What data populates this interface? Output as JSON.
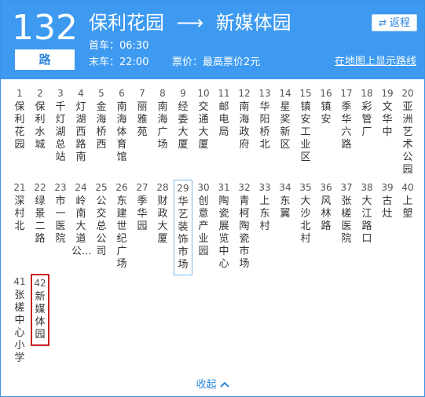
{
  "route": {
    "number": "132",
    "unit": "路",
    "from": "保利花园",
    "arrow": "⟶",
    "to": "新媒体园",
    "first_bus": "首车：06:30",
    "last_bus": "末车：22:00",
    "fare": "票价：最高票价2元",
    "reverse_label": "返程",
    "reverse_icon": "⇄",
    "show_map_label": "在地图上显示路线"
  },
  "stops": [
    {
      "num": "1",
      "name": "保利花园"
    },
    {
      "num": "2",
      "name": "保利水城"
    },
    {
      "num": "3",
      "name": "千灯湖总站"
    },
    {
      "num": "4",
      "name": "灯湖西路南"
    },
    {
      "num": "5",
      "name": "金海桥西"
    },
    {
      "num": "6",
      "name": "南海体育馆"
    },
    {
      "num": "7",
      "name": "丽雅苑"
    },
    {
      "num": "8",
      "name": "南海广场"
    },
    {
      "num": "9",
      "name": "经委大厦"
    },
    {
      "num": "10",
      "name": "交通大厦"
    },
    {
      "num": "11",
      "name": "邮电局"
    },
    {
      "num": "12",
      "name": "南海政府"
    },
    {
      "num": "13",
      "name": "华阳桥北"
    },
    {
      "num": "14",
      "name": "星奖新区"
    },
    {
      "num": "15",
      "name": "镇安工业区"
    },
    {
      "num": "16",
      "name": "镇安"
    },
    {
      "num": "17",
      "name": "季华六路"
    },
    {
      "num": "18",
      "name": "彩管厂"
    },
    {
      "num": "19",
      "name": "文华中"
    },
    {
      "num": "20",
      "name": "亚洲艺术公园"
    },
    {
      "num": "21",
      "name": "深村北"
    },
    {
      "num": "22",
      "name": "绿景二路"
    },
    {
      "num": "23",
      "name": "市一医院"
    },
    {
      "num": "24",
      "name": "岭南大道公..."
    },
    {
      "num": "25",
      "name": "公交总公司"
    },
    {
      "num": "26",
      "name": "东建世纪广场"
    },
    {
      "num": "27",
      "name": "季华园"
    },
    {
      "num": "28",
      "name": "财政大厦"
    },
    {
      "num": "29",
      "name": "华艺装饰市场"
    },
    {
      "num": "30",
      "name": "创意产业园"
    },
    {
      "num": "31",
      "name": "陶瓷展览中心"
    },
    {
      "num": "32",
      "name": "青柯陶瓷市场"
    },
    {
      "num": "33",
      "name": "上东村"
    },
    {
      "num": "34",
      "name": "东翼"
    },
    {
      "num": "35",
      "name": "大沙北村"
    },
    {
      "num": "36",
      "name": "风林路"
    },
    {
      "num": "37",
      "name": "张槎医院"
    },
    {
      "num": "38",
      "name": "大江路口"
    },
    {
      "num": "39",
      "name": "古灶"
    },
    {
      "num": "40",
      "name": "上塱"
    },
    {
      "num": "41",
      "name": "张槎中心小学"
    },
    {
      "num": "42",
      "name": "新媒体园"
    }
  ],
  "collapse": {
    "label": "收起",
    "icon": "chevron-up-icon"
  },
  "colors": {
    "header_bg": "#3d9af0",
    "accent": "#2b86dc",
    "destination_border": "#cc2222",
    "hover_border": "#7ab6ea"
  }
}
